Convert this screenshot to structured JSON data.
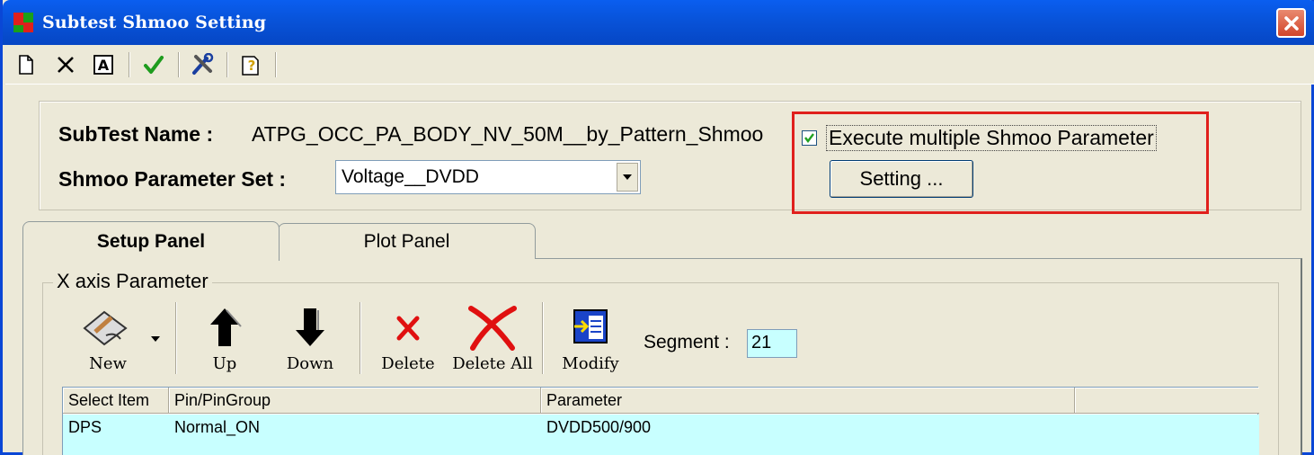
{
  "window": {
    "title": "Subtest Shmoo Setting"
  },
  "toolbar": {
    "items": [
      "new-doc-icon",
      "delete-icon",
      "rename-icon",
      "apply-check-icon",
      "tools-icon",
      "help-icon"
    ]
  },
  "header": {
    "subtest_label": "SubTest Name :",
    "subtest_value": "ATPG_OCC_PA_BODY_NV_50M__by_Pattern_Shmoo",
    "paramset_label": "Shmoo Parameter Set :",
    "paramset_value": "Voltage__DVDD",
    "multi_checkbox_checked": true,
    "multi_checkbox_label": "Execute multiple Shmoo Parameter",
    "setting_button": "Setting ..."
  },
  "tabs": [
    {
      "label": "Setup Panel",
      "active": true
    },
    {
      "label": "Plot Panel",
      "active": false
    }
  ],
  "xaxis": {
    "group_label": "X axis Parameter",
    "buttons": {
      "new": "New",
      "up": "Up",
      "down": "Down",
      "delete": "Delete",
      "delete_all": "Delete All",
      "modify": "Modify"
    },
    "segment_label": "Segment :",
    "segment_value": "21",
    "grid": {
      "columns": [
        "Select Item",
        "Pin/PinGroup",
        "Parameter",
        ""
      ],
      "rows": [
        [
          "DPS",
          "Normal_ON",
          "DVDD500/900",
          ""
        ]
      ]
    }
  },
  "colors": {
    "titlebar": "#0853d9",
    "highlight_box": "#e0201c",
    "selected_row": "#c8ffff"
  }
}
